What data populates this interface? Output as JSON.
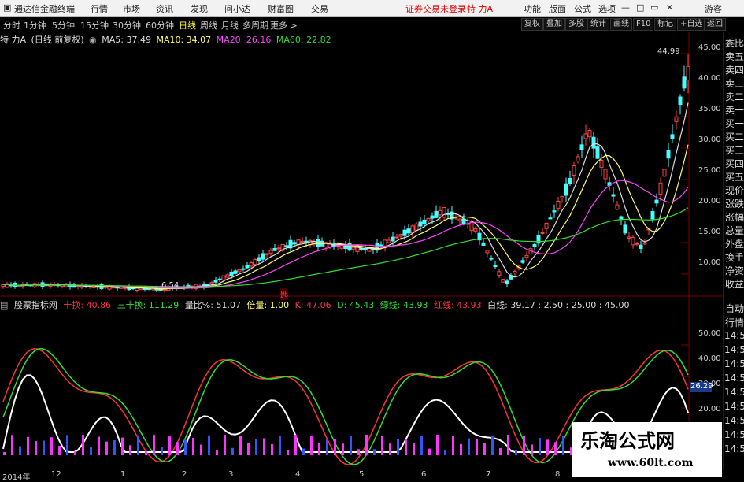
{
  "titlebar": {
    "app_name": "通达信金融终端",
    "menus": [
      "行情",
      "市场",
      "资讯",
      "发现",
      "问小达",
      "财富圈",
      "交易"
    ],
    "login_status": "证券交易未登录",
    "stock_title": "特 力A",
    "right_menus": [
      "功能",
      "版面",
      "公式",
      "选项"
    ],
    "guest": "游客"
  },
  "periods": [
    "分时",
    "1分钟",
    "5分钟",
    "15分钟",
    "30分钟",
    "60分钟",
    "日线",
    "周线",
    "月线",
    "多周期",
    "更多 >"
  ],
  "selected_period": "日线",
  "right_buttons": [
    "复权",
    "叠加",
    "多股",
    "统计",
    "画线",
    "F10",
    "标记",
    "+自选",
    "返回"
  ],
  "main_legend": {
    "stock": "特 力A",
    "adjust": "(日线 前复权)",
    "items": [
      {
        "label": "MA5: 37.49",
        "color": "#dddddd"
      },
      {
        "label": "MA10: 34.07",
        "color": "#ffff66"
      },
      {
        "label": "MA20: 26.16",
        "color": "#ff44ff"
      },
      {
        "label": "MA60: 22.82",
        "color": "#33dd33"
      }
    ]
  },
  "main_annotations": {
    "high_label": "44.99",
    "low_label": "6.54",
    "marker": "匙"
  },
  "sub_legend": {
    "name": "股票指标网",
    "items": [
      {
        "label": "十换: 40.86",
        "color": "#ff3333"
      },
      {
        "label": "三十换: 111.29",
        "color": "#33dd33"
      },
      {
        "label": "量比%: 51.07",
        "color": "#dddddd"
      },
      {
        "label": "倍量: 1.00",
        "color": "#ffff66"
      },
      {
        "label": "K: 47.06",
        "color": "#ff3333"
      },
      {
        "label": "D: 45.43",
        "color": "#33dd33"
      },
      {
        "label": "绿线: 43.93",
        "color": "#33dd33"
      },
      {
        "label": "红线: 43.93",
        "color": "#ff3333"
      },
      {
        "label": "白线: 39.17 : 2.50 : 25.00 : 45.00",
        "color": "#dddddd"
      }
    ]
  },
  "right_panel": {
    "upper": [
      "委比",
      "卖五",
      "卖四",
      "卖三",
      "卖二",
      "卖一",
      "买一",
      "买二",
      "买三",
      "买四",
      "买五",
      "现价",
      "涨跌",
      "涨幅",
      "总量",
      "外盘",
      "换手",
      "净资",
      "收益"
    ],
    "lower": [
      "自动",
      "行情",
      "14:5",
      "14:5",
      "14:5",
      "14:5",
      "14:5",
      "14:5",
      "14:5",
      "14:5",
      "14:5"
    ]
  },
  "main_axis": [
    "45.00",
    "40.00",
    "35.00",
    "30.00",
    "25.00",
    "20.00",
    "15.00",
    "10.00"
  ],
  "sub_axis": [
    "50.00",
    "40.00",
    "30.00",
    "20.00"
  ],
  "sub_value_box": "26.29",
  "date_axis": [
    "2014年",
    "12",
    "1",
    "2",
    "3",
    "4",
    "5",
    "6",
    "7",
    "8"
  ],
  "watermark": {
    "title": "乐淘公式网",
    "url": "www.60lt.com"
  },
  "chart_data": [
    {
      "type": "candlestick",
      "title": "特 力A",
      "ylim": [
        6,
        46
      ],
      "yticks": [
        10,
        15,
        20,
        25,
        30,
        35,
        40,
        45
      ],
      "series": [
        {
          "name": "MA5",
          "values": []
        },
        {
          "name": "MA10",
          "values": []
        },
        {
          "name": "MA20",
          "values": []
        },
        {
          "name": "MA60",
          "values": []
        }
      ],
      "annotations": {
        "high": 44.99,
        "low": 6.54
      }
    },
    {
      "type": "line",
      "title": "股票指标网",
      "ylim": [
        15,
        55
      ],
      "yticks": [
        20,
        30,
        40,
        50
      ],
      "series": [
        {
          "name": "K",
          "values": []
        },
        {
          "name": "D",
          "values": []
        },
        {
          "name": "白线",
          "values": []
        }
      ]
    }
  ]
}
